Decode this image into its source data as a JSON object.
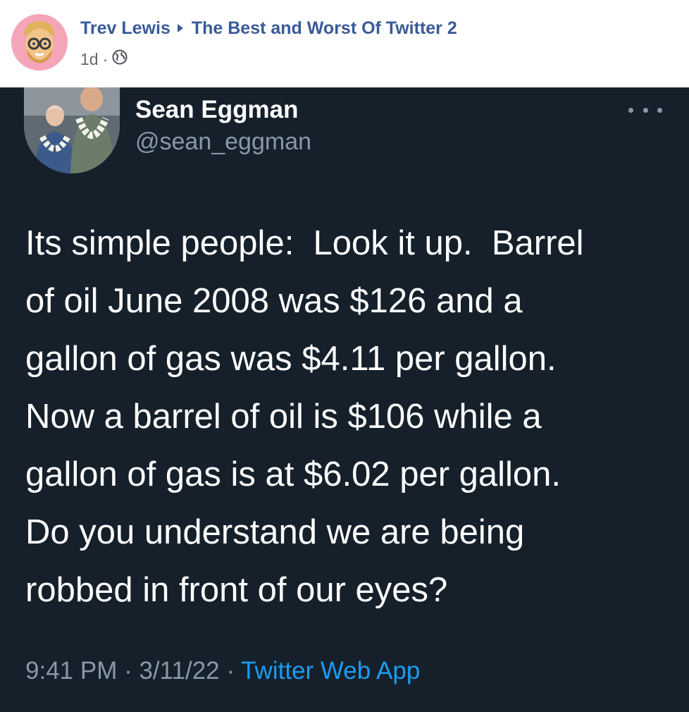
{
  "post": {
    "author": "Trev Lewis",
    "group": "The Best and Worst Of Twitter 2",
    "time": "1d",
    "dot": "·",
    "icons": {
      "avatar": "memoji-avatar",
      "arrow": "caret-right-icon",
      "audience": "globe-icon"
    },
    "colors": {
      "link": "#3a5a99",
      "meta": "#65676b",
      "avatar_bg": "#f4a6b8"
    }
  },
  "tweet": {
    "name": "Sean Eggman",
    "handle": "@sean_eggman",
    "text_lines": [
      "Its simple people:  Look it up.  Barrel",
      "of oil June 2008 was $126 and a",
      "gallon of gas was $4.11 per gallon.",
      "Now a barrel of oil is $106 while a",
      "gallon of gas is at $6.02 per gallon.",
      "Do you understand we are being",
      "robbed in front of our eyes?"
    ],
    "timestamp": "9:41 PM · 3/11/22 · ",
    "source": "Twitter Web App",
    "icons": {
      "more": "more-dots-icon",
      "avatar": "profile-photo"
    },
    "colors": {
      "background": "#15202b",
      "secondary": "#8899a6",
      "accent": "#1d9bf0"
    }
  }
}
